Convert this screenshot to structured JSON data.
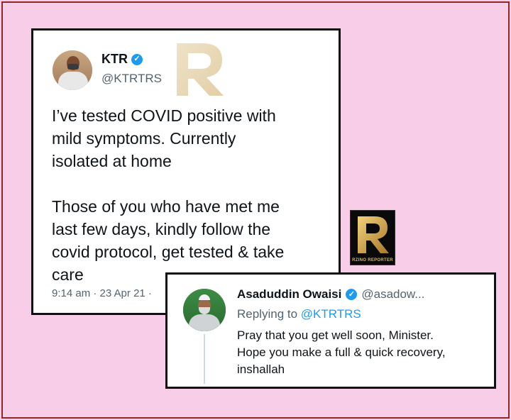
{
  "main_tweet": {
    "name": "KTR",
    "handle": "@KTRTRS",
    "paragraphs": [
      "I’ve tested COVID positive with\nmild symptoms. Currently\nisolated at home",
      "Those of you who have met me\nlast few days, kindly follow the\ncovid protocol, get tested & take\ncare"
    ],
    "timestamp": "9:14 am · 23 Apr 21 ·"
  },
  "logo": {
    "text": "RZINO REPORTER",
    "colors": {
      "gold": "#c9a24a",
      "background": "#0a0a0a"
    }
  },
  "reply": {
    "name": "Asaduddin Owaisi",
    "handle": "@asadow...",
    "replying_prefix": "Replying to",
    "replying_to": "@KTRTRS",
    "text": "Pray that you get well soon, Minister.\nHope you make a full & quick recovery,\ninshallah"
  },
  "icons": {
    "verified": "verified-badge-icon"
  },
  "colors": {
    "page_background": "#f7cde8",
    "frame": "#8b2a2a",
    "twitter_blue": "#1d9bf0",
    "secondary_text": "#536471"
  }
}
